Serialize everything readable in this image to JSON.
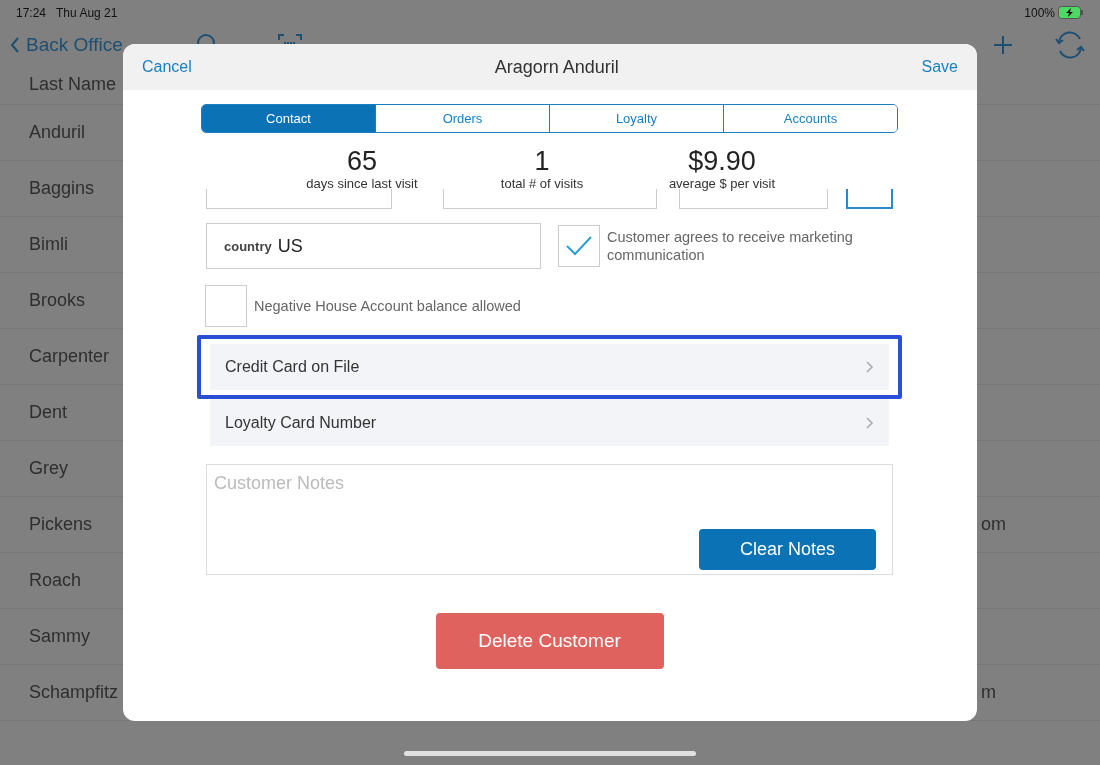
{
  "status_bar": {
    "time": "17:24",
    "date": "Thu Aug 21",
    "battery": "100%"
  },
  "nav_bar": {
    "back": "Back Office"
  },
  "list": {
    "header": "Last Name",
    "rows": [
      {
        "last_name": "Anduril"
      },
      {
        "last_name": "Baggins"
      },
      {
        "last_name": "Bimli"
      },
      {
        "last_name": "Brooks"
      },
      {
        "last_name": "Carpenter"
      },
      {
        "last_name": "Dent"
      },
      {
        "last_name": "Grey"
      },
      {
        "last_name": "Pickens",
        "email": "om"
      },
      {
        "last_name": "Roach"
      },
      {
        "last_name": "Sammy"
      },
      {
        "last_name": "Schampfitz",
        "email": "m"
      }
    ]
  },
  "modal": {
    "cancel": "Cancel",
    "title": "Aragorn Anduril",
    "save": "Save",
    "tabs": [
      {
        "label": "Contact",
        "selected": true
      },
      {
        "label": "Orders",
        "selected": false
      },
      {
        "label": "Loyalty",
        "selected": false
      },
      {
        "label": "Accounts",
        "selected": false
      }
    ],
    "stats": [
      {
        "value": "65",
        "label": "days since last visit"
      },
      {
        "value": "1",
        "label": "total # of visits"
      },
      {
        "value": "$9.90",
        "label": "average $ per visit"
      }
    ],
    "country": {
      "label": "country",
      "value": "US"
    },
    "marketing": {
      "label": "Customer agrees to receive marketing communication",
      "checked": true
    },
    "negative_balance": {
      "label": "Negative House Account balance allowed",
      "checked": false
    },
    "links": [
      {
        "label": "Credit Card on File",
        "highlighted": true
      },
      {
        "label": "Loyalty Card Number",
        "highlighted": false
      }
    ],
    "notes": {
      "placeholder": "Customer Notes"
    },
    "clear_notes": "Clear Notes",
    "delete": "Delete Customer"
  }
}
